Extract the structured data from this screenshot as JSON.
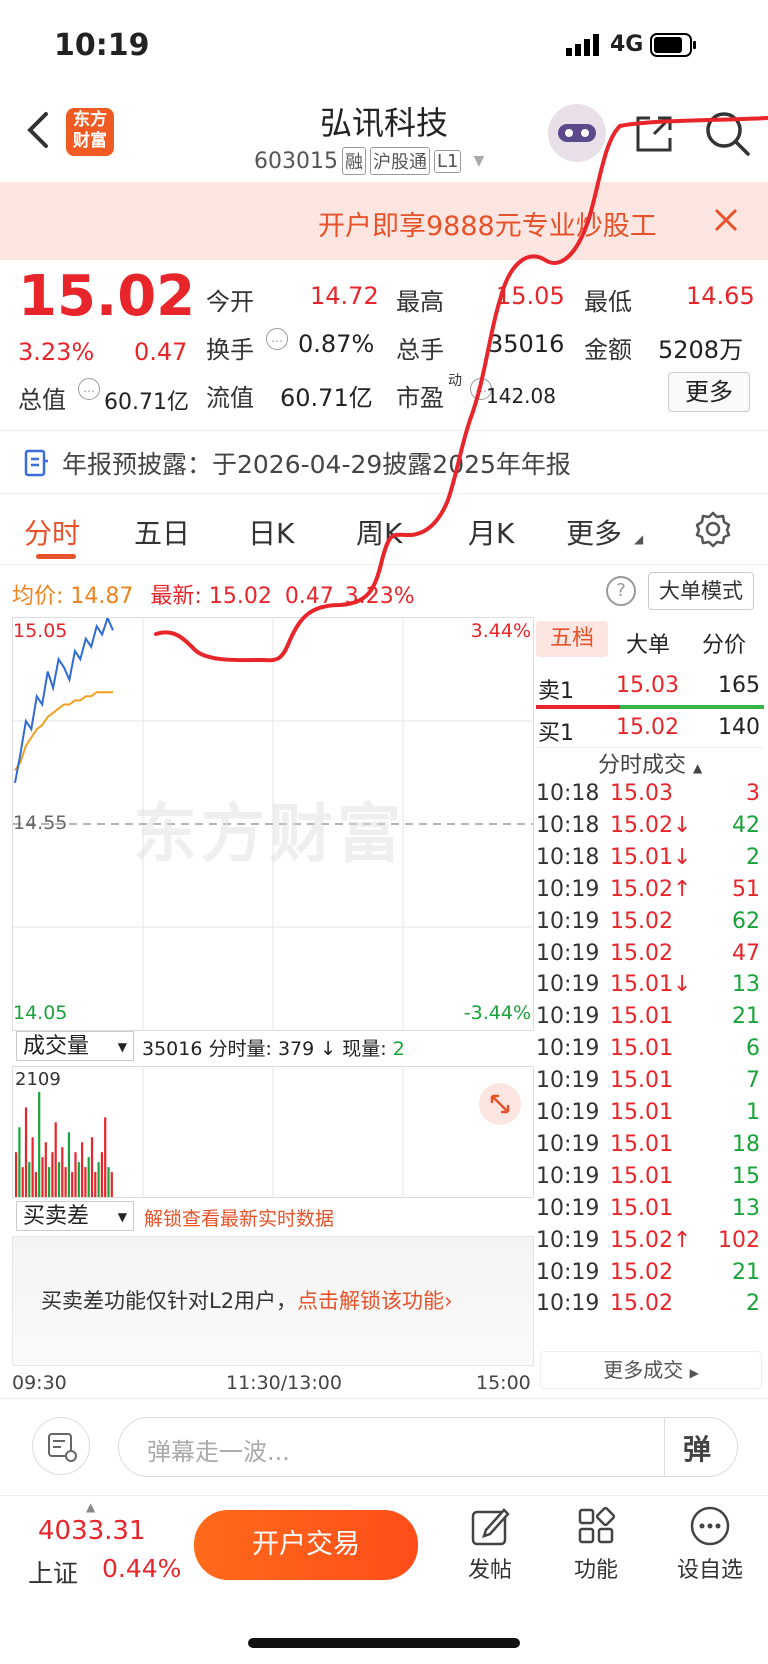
{
  "status_bar": {
    "time": "10:19",
    "network": "4G"
  },
  "header": {
    "back_icon": "chevron-left-icon",
    "logo_line1": "东方",
    "logo_line2": "财富",
    "title": "弘讯科技",
    "code": "603015",
    "badges": [
      "融",
      "沪股通",
      "L1"
    ],
    "share_icon": "share-icon",
    "search_icon": "search-icon"
  },
  "banner": {
    "text": "开户即享9888元专业炒股工",
    "close_icon": "close-icon"
  },
  "quote": {
    "price": "15.02",
    "change_pct": "3.23%",
    "change": "0.47",
    "open_label": "今开",
    "open": "14.72",
    "high_label": "最高",
    "high": "15.05",
    "low_label": "最低",
    "low": "14.65",
    "turnover_label": "换手",
    "turnover": "0.87%",
    "volume_label": "总手",
    "volume": "35016",
    "amount_label": "金额",
    "amount": "5208万",
    "mktcap_label": "总值",
    "mktcap": "60.71亿",
    "float_label": "流值",
    "float": "60.71亿",
    "pe_label": "市盈",
    "pe_sup": "动",
    "pe": "142.08",
    "more_label": "更多"
  },
  "notice": {
    "text": "年报预披露：于2026-04-29披露2025年年报"
  },
  "tabs": [
    "分时",
    "五日",
    "日K",
    "周K",
    "月K",
    "更多"
  ],
  "chart_info": {
    "avg_label": "均价:",
    "avg": "14.87",
    "latest_label": "最新:",
    "latest": "15.02",
    "latest_change": "0.47",
    "latest_pct": "3.23%",
    "big_order_mode": "大单模式"
  },
  "chart_data": {
    "type": "line",
    "ylim": [
      14.05,
      15.05
    ],
    "y_ticks": [
      "15.05",
      "14.55",
      "14.05"
    ],
    "pct_ticks": [
      "3.44%",
      "-3.44%"
    ],
    "x_ticks": [
      "09:30",
      "11:30/13:00",
      "15:00"
    ],
    "prev_close": 14.55,
    "series": [
      {
        "values": [
          14.65,
          14.72,
          14.8,
          14.78,
          14.86,
          14.84,
          14.92,
          14.88,
          14.95,
          14.93,
          14.9,
          14.97,
          14.95,
          15.0,
          14.98,
          15.03,
          15.01,
          15.05,
          15.02
        ]
      },
      {
        "values": [
          14.68,
          14.7,
          14.74,
          14.76,
          14.78,
          14.79,
          14.81,
          14.82,
          14.83,
          14.84,
          14.84,
          14.85,
          14.85,
          14.86,
          14.86,
          14.87,
          14.87,
          14.87,
          14.87
        ]
      }
    ],
    "volume_max": "2109",
    "volume_bars": [
      900,
      1400,
      600,
      1800,
      700,
      1200,
      500,
      2109,
      800,
      1100,
      600,
      900,
      1500,
      700,
      1000,
      600,
      1300,
      500,
      900,
      700,
      1100,
      600,
      800,
      1200,
      500,
      700,
      900,
      1600,
      600,
      500
    ]
  },
  "volume_section": {
    "selector": "成交量",
    "total": "35016",
    "minute_label": "分时量:",
    "minute": "379",
    "current_label": "现量:",
    "current": "2"
  },
  "diff_section": {
    "selector": "买卖差",
    "unlock_link": "解锁查看最新实时数据",
    "msg": "买卖差功能仅针对L2用户，",
    "msg_link": "点击解锁该功能"
  },
  "watermark": "东方财富",
  "right_panel": {
    "tabs": [
      "五档",
      "大单",
      "分价"
    ],
    "sell1": {
      "label": "卖1",
      "price": "15.03",
      "qty": "165"
    },
    "buy1": {
      "label": "买1",
      "price": "15.02",
      "qty": "140"
    },
    "ticks_title": "分时成交",
    "ticks": [
      {
        "t": "10:18",
        "p": "15.03",
        "d": "",
        "v": "3",
        "c": "red"
      },
      {
        "t": "10:18",
        "p": "15.02",
        "d": "↓",
        "v": "42",
        "c": "green"
      },
      {
        "t": "10:18",
        "p": "15.01",
        "d": "↓",
        "v": "2",
        "c": "green"
      },
      {
        "t": "10:19",
        "p": "15.02",
        "d": "↑",
        "v": "51",
        "c": "red"
      },
      {
        "t": "10:19",
        "p": "15.02",
        "d": "",
        "v": "62",
        "c": "green"
      },
      {
        "t": "10:19",
        "p": "15.02",
        "d": "",
        "v": "47",
        "c": "red"
      },
      {
        "t": "10:19",
        "p": "15.01",
        "d": "↓",
        "v": "13",
        "c": "green"
      },
      {
        "t": "10:19",
        "p": "15.01",
        "d": "",
        "v": "21",
        "c": "green"
      },
      {
        "t": "10:19",
        "p": "15.01",
        "d": "",
        "v": "6",
        "c": "green"
      },
      {
        "t": "10:19",
        "p": "15.01",
        "d": "",
        "v": "7",
        "c": "green"
      },
      {
        "t": "10:19",
        "p": "15.01",
        "d": "",
        "v": "1",
        "c": "green"
      },
      {
        "t": "10:19",
        "p": "15.01",
        "d": "",
        "v": "18",
        "c": "green"
      },
      {
        "t": "10:19",
        "p": "15.01",
        "d": "",
        "v": "15",
        "c": "green"
      },
      {
        "t": "10:19",
        "p": "15.01",
        "d": "",
        "v": "13",
        "c": "green"
      },
      {
        "t": "10:19",
        "p": "15.02",
        "d": "↑",
        "v": "102",
        "c": "red"
      },
      {
        "t": "10:19",
        "p": "15.02",
        "d": "",
        "v": "21",
        "c": "green"
      },
      {
        "t": "10:19",
        "p": "15.02",
        "d": "",
        "v": "2",
        "c": "green"
      }
    ],
    "more_ticks": "更多成交"
  },
  "comment": {
    "placeholder": "弹幕走一波...",
    "danmu_label": "弹"
  },
  "bottom": {
    "index_value": "4033.31",
    "index_name": "上证",
    "index_pct": "0.44%",
    "trade_button": "开户交易",
    "post_label": "发帖",
    "func_label": "功能",
    "watch_label": "设自选"
  }
}
